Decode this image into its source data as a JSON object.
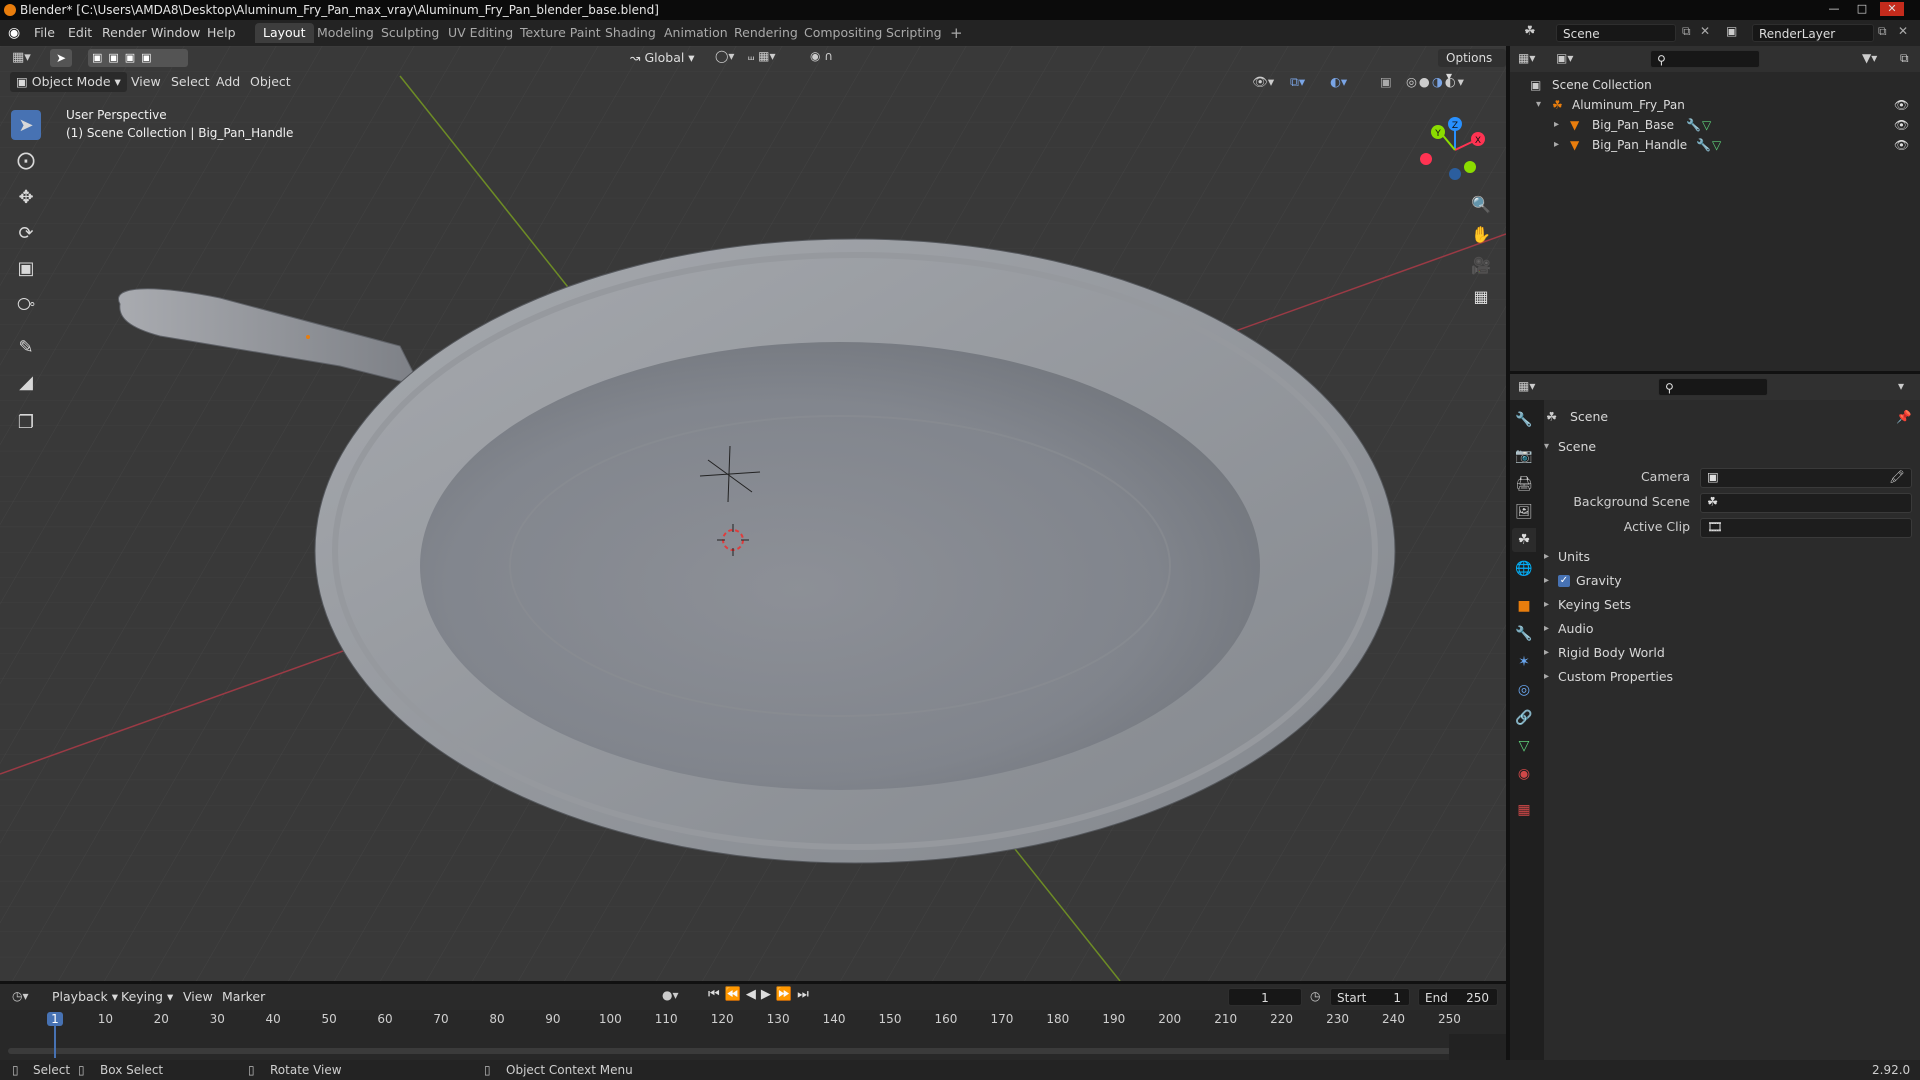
{
  "window": {
    "title": "Blender* [C:\\Users\\AMDA8\\Desktop\\Aluminum_Fry_Pan_max_vray\\Aluminum_Fry_Pan_blender_base.blend]"
  },
  "menu": [
    "File",
    "Edit",
    "Render",
    "Window",
    "Help"
  ],
  "workspaces": [
    "Layout",
    "Modeling",
    "Sculpting",
    "UV Editing",
    "Texture Paint",
    "Shading",
    "Animation",
    "Rendering",
    "Compositing",
    "Scripting"
  ],
  "active_workspace": "Layout",
  "scene_field": "Scene",
  "view_layer_field": "RenderLayer",
  "viewport": {
    "orientation": "Global",
    "options_label": "Options",
    "mode": "Object Mode",
    "menus": [
      "View",
      "Select",
      "Add",
      "Object"
    ],
    "overlay_line1": "User Perspective",
    "overlay_line2": "(1) Scene Collection | Big_Pan_Handle",
    "gizmo_axes": [
      "Z",
      "Y",
      "X"
    ]
  },
  "outliner": {
    "root": "Scene Collection",
    "items": [
      {
        "label": "Aluminum_Fry_Pan",
        "depth": 1
      },
      {
        "label": "Big_Pan_Base",
        "depth": 2
      },
      {
        "label": "Big_Pan_Handle",
        "depth": 2
      }
    ]
  },
  "properties": {
    "context": "Scene",
    "panel_title": "Scene",
    "fields": [
      {
        "label": "Camera"
      },
      {
        "label": "Background Scene"
      },
      {
        "label": "Active Clip"
      }
    ],
    "subpanels": [
      "Units",
      "Gravity",
      "Keying Sets",
      "Audio",
      "Rigid Body World",
      "Custom Properties"
    ]
  },
  "timeline": {
    "menus": [
      "Playback",
      "Keying",
      "View",
      "Marker"
    ],
    "current_frame": "1",
    "start_label": "Start",
    "start": "1",
    "end_label": "End",
    "end": "250",
    "ruler": [
      "1",
      "10",
      "20",
      "30",
      "40",
      "50",
      "60",
      "70",
      "80",
      "90",
      "100",
      "110",
      "120",
      "130",
      "140",
      "150",
      "160",
      "170",
      "180",
      "190",
      "200",
      "210",
      "220",
      "230",
      "240",
      "250"
    ]
  },
  "status": {
    "select": "Select",
    "box_select": "Box Select",
    "rotate_view": "Rotate View",
    "context_menu": "Object Context Menu",
    "version": "2.92.0"
  },
  "colors": {
    "accent": "#4772b3",
    "x_axis": "#ff3352",
    "y_axis": "#8bdc00",
    "z_axis": "#2890ff",
    "blender_orange": "#e87d0d"
  }
}
